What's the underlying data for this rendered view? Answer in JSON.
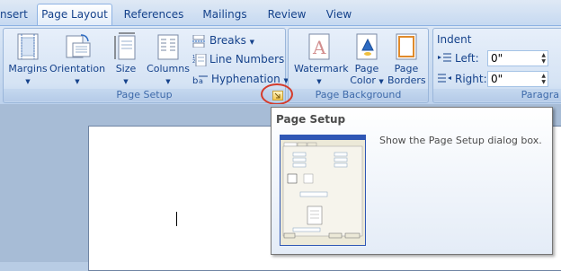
{
  "tabs": [
    {
      "label": "nsert"
    },
    {
      "label": "Page Layout"
    },
    {
      "label": "References"
    },
    {
      "label": "Mailings"
    },
    {
      "label": "Review"
    },
    {
      "label": "View"
    }
  ],
  "groups": {
    "page_setup": {
      "label": "Page Setup",
      "margins": "Margins",
      "orientation": "Orientation",
      "size": "Size",
      "columns": "Columns",
      "breaks": "Breaks",
      "line_numbers": "Line Numbers",
      "hyphenation": "Hyphenation"
    },
    "page_background": {
      "label": "Page Background",
      "watermark": "Watermark",
      "page_color_1": "Page",
      "page_color_2": "Color",
      "page_borders_1": "Page",
      "page_borders_2": "Borders"
    },
    "paragraph": {
      "label": "Paragra",
      "indent_title": "Indent",
      "left_label": "Left:",
      "left_value": "0\"",
      "right_label": "Right:",
      "right_value": "0\""
    }
  },
  "tooltip": {
    "title": "Page Setup",
    "description": "Show the Page Setup dialog box."
  },
  "colors": {
    "accent": "#15428b",
    "highlight_ring": "#d53b2b"
  }
}
